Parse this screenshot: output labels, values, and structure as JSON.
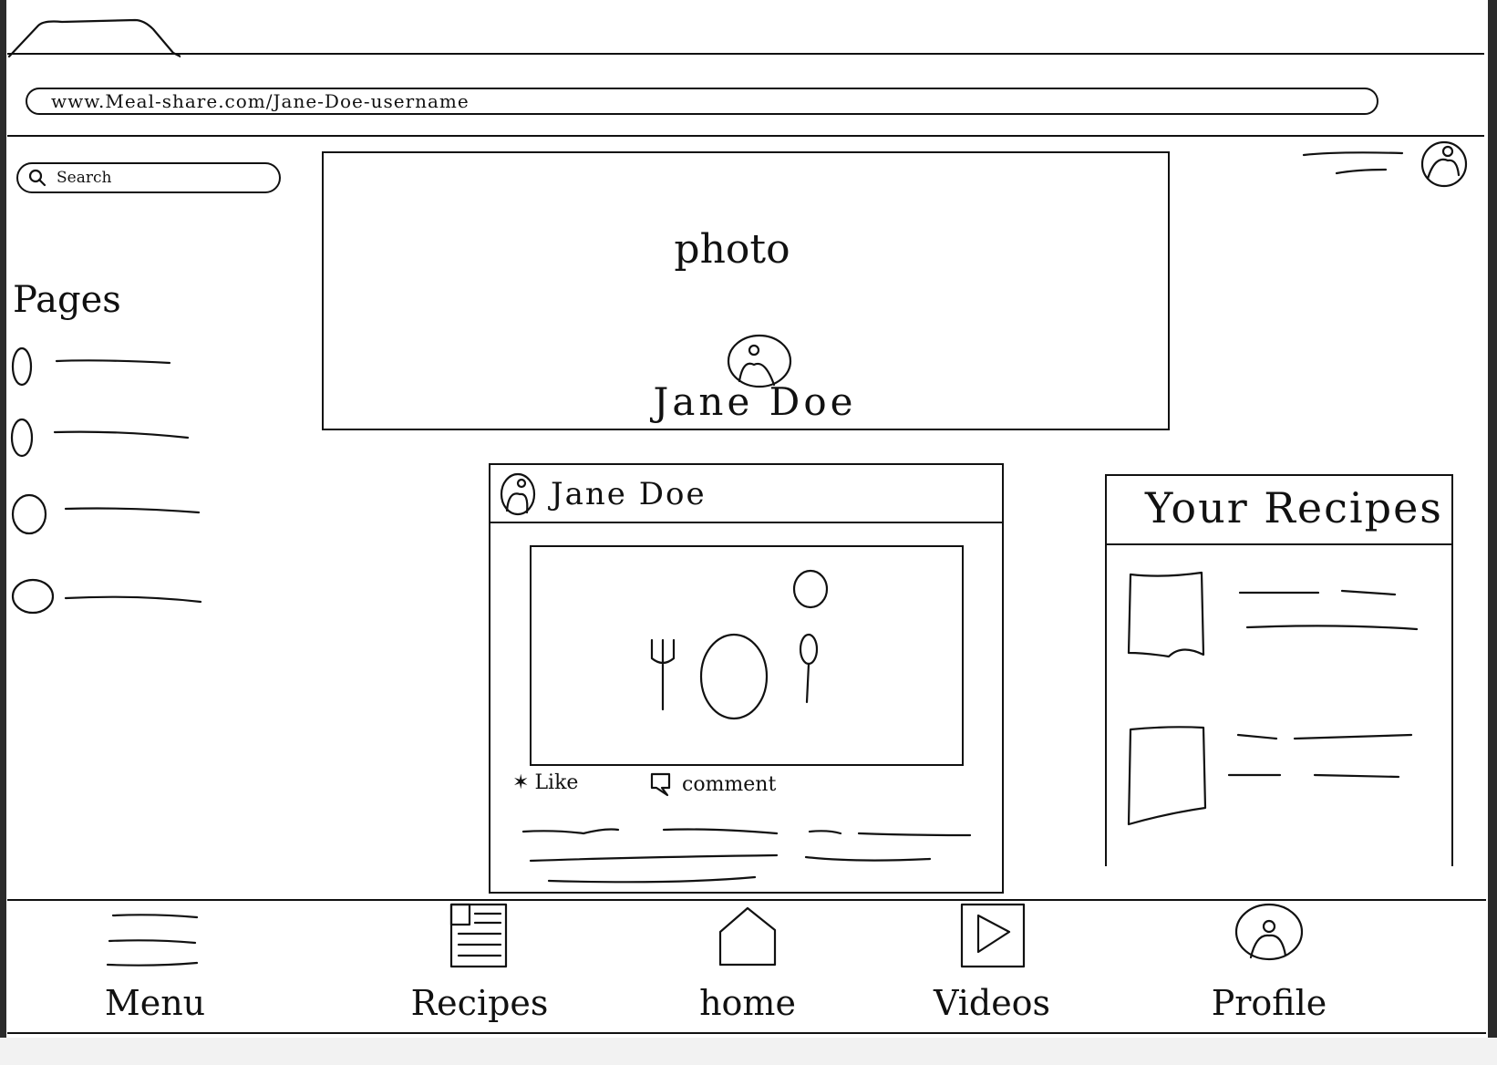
{
  "browser": {
    "url": "www.Meal-share.com/Jane-Doe-username"
  },
  "search": {
    "placeholder": "Search"
  },
  "sidebar": {
    "title": "Pages"
  },
  "cover": {
    "photo_label": "photo",
    "name": "Jane Doe"
  },
  "post": {
    "author": "Jane Doe",
    "like_label": "Like",
    "comment_label": "comment"
  },
  "recipes_panel": {
    "title": "Your Recipes"
  },
  "bottom_nav": {
    "items": [
      {
        "label": "Menu",
        "icon": "hamburger-menu-icon"
      },
      {
        "label": "Recipes",
        "icon": "recipe-page-icon"
      },
      {
        "label": "home",
        "icon": "home-icon"
      },
      {
        "label": "Videos",
        "icon": "play-icon"
      },
      {
        "label": "Profile",
        "icon": "user-icon"
      }
    ]
  }
}
